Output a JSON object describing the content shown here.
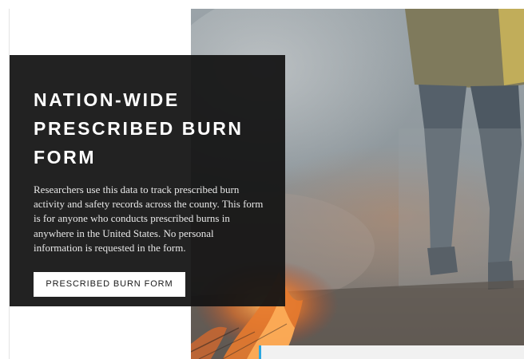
{
  "hero": {
    "title": "NATION-WIDE PRESCRIBED BURN FORM",
    "description": "Researchers use this data to track prescribed burn activity and safety records across the county. This form is for anyone who conducts prescribed burns in anywhere in the United States. No personal information is requested in the form.",
    "button_label": "PRESCRIBED BURN FORM"
  },
  "colors": {
    "card_background": "#141414",
    "button_background": "#ffffff",
    "accent": "#2aa7e0",
    "smoke": "#8f9aa2",
    "flame": "#e0702a"
  }
}
